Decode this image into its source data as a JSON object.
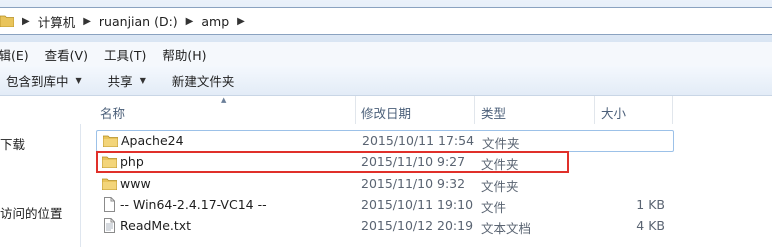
{
  "breadcrumb": {
    "items": [
      "计算机",
      "ruanjian (D:)",
      "amp"
    ]
  },
  "menu": {
    "items": [
      "编辑(E)",
      "查看(V)",
      "工具(T)",
      "帮助(H)"
    ]
  },
  "toolbar": {
    "include_library": "包含到库中",
    "share": "共享",
    "new_folder": "新建文件夹"
  },
  "nav": {
    "downloads": "下载",
    "recent": "访问的位置"
  },
  "columns": {
    "name": "名称",
    "date": "修改日期",
    "type": "类型",
    "size": "大小"
  },
  "files": [
    {
      "name": "Apache24",
      "date": "2015/10/11 17:54",
      "type": "文件夹",
      "size": "",
      "icon": "folder-icon"
    },
    {
      "name": "php",
      "date": "2015/11/10 9:27",
      "type": "文件夹",
      "size": "",
      "icon": "folder-icon"
    },
    {
      "name": "www",
      "date": "2015/11/10 9:32",
      "type": "文件夹",
      "size": "",
      "icon": "folder-icon"
    },
    {
      "name": "-- Win64-2.4.17-VC14  --",
      "date": "2015/10/11 19:10",
      "type": "文件",
      "size": "1 KB",
      "icon": "file-icon"
    },
    {
      "name": "ReadMe.txt",
      "date": "2015/10/12 20:19",
      "type": "文本文档",
      "size": "4 KB",
      "icon": "text-file-icon"
    }
  ],
  "colors": {
    "highlight": "#e0302a",
    "folder": "#e9c45b"
  }
}
